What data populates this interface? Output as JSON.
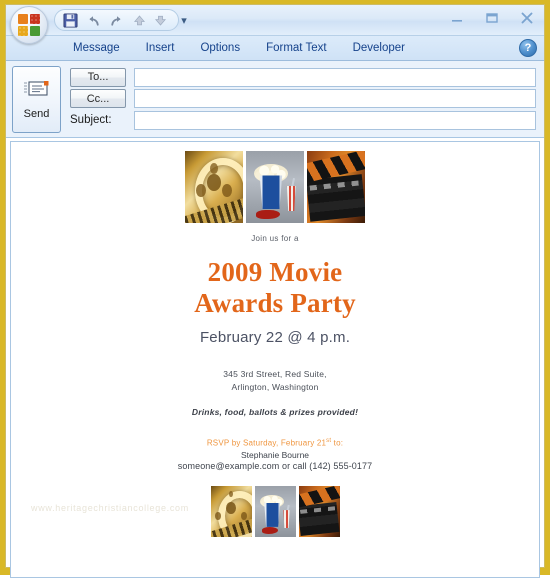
{
  "window": {
    "office_orb": "office-orb",
    "minimize_label": "–",
    "maximize_label": "❐",
    "close_label": "✕",
    "help_label": "?"
  },
  "quick_access_toolbar": {
    "items": [
      {
        "name": "save-icon",
        "label": "save"
      },
      {
        "name": "undo-icon",
        "label": "undo"
      },
      {
        "name": "redo-icon",
        "label": "redo"
      },
      {
        "name": "previous-item-icon",
        "label": "previous item"
      },
      {
        "name": "next-item-icon",
        "label": "next item"
      }
    ],
    "dropdown_label": "▾"
  },
  "ribbon": {
    "tabs": [
      {
        "label": "Message"
      },
      {
        "label": "Insert"
      },
      {
        "label": "Options"
      },
      {
        "label": "Format Text"
      },
      {
        "label": "Developer"
      }
    ]
  },
  "header": {
    "send_label": "Send",
    "to_label": "To...",
    "cc_label": "Cc...",
    "subject_label": "Subject:",
    "to_value": "",
    "cc_value": "",
    "subject_value": "",
    "to_placeholder": "",
    "cc_placeholder": "",
    "subject_placeholder": ""
  },
  "invitation": {
    "intro": "Join us for a",
    "title_line1": "2009 Movie",
    "title_line2": "Awards Party",
    "date_time": "February 22 @ 4 p.m.",
    "address_line1": "345 3rd Street, Red Suite,",
    "address_line2": "Arlington, Washington",
    "amenities": "Drinks, food, ballots & prizes provided!",
    "rsvp_prefix": "RSVP by Saturday, February 21",
    "rsvp_superscript": "st",
    "rsvp_suffix": " to:",
    "contact_name": "Stephanie Bourne",
    "contact_details": "someone@example.com or call (142) 555-0177",
    "watermark": "www.heritagechristiancollege.com",
    "images": [
      {
        "name": "film-reel-image",
        "alt": "film reel"
      },
      {
        "name": "popcorn-drink-image",
        "alt": "popcorn and drink"
      },
      {
        "name": "clapperboard-image",
        "alt": "clapperboard"
      }
    ]
  },
  "colors": {
    "frame_gold": "#d9b827",
    "title_orange": "#e2661a",
    "rsvp_orange": "#ef9640",
    "date_slate": "#4c5264",
    "tab_blue": "#15428b",
    "header_blue": "#eaf2fb"
  }
}
